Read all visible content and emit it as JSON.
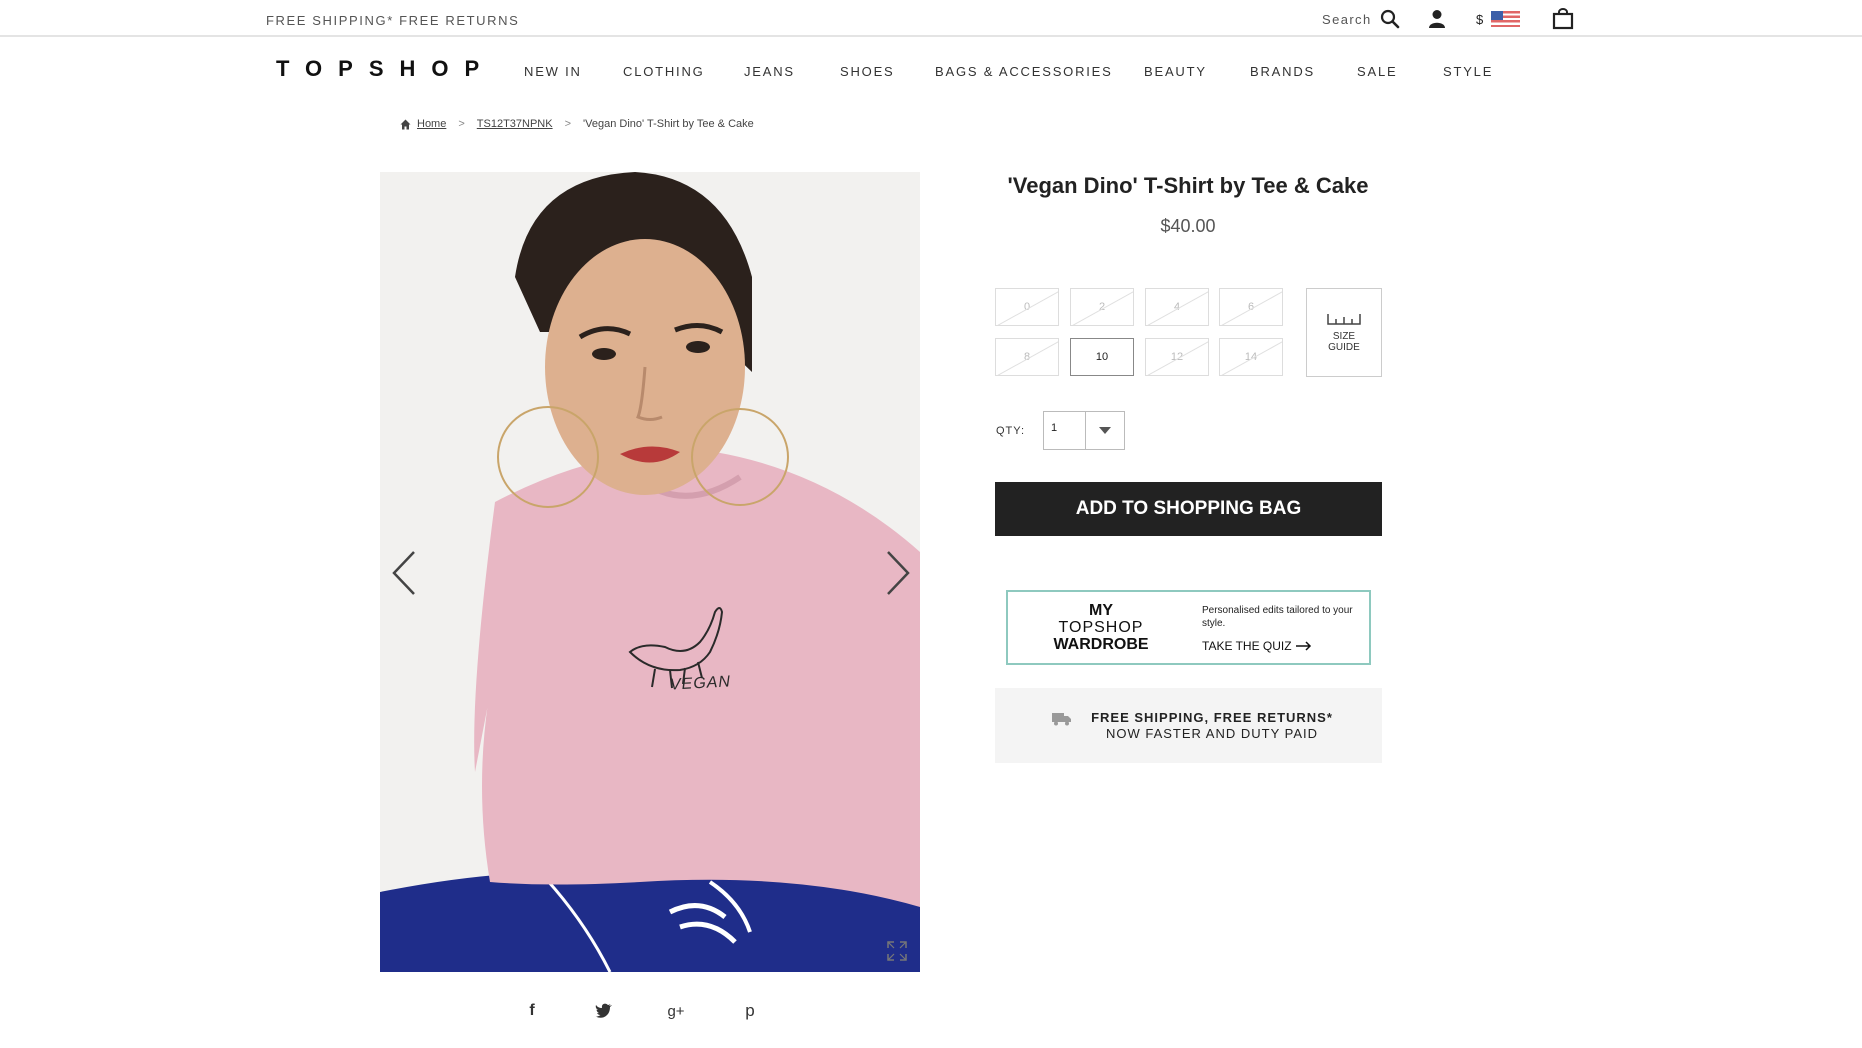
{
  "topbar": {
    "shipping_note": "FREE SHIPPING* FREE RETURNS",
    "search_label": "Search",
    "currency_symbol": "$"
  },
  "brand": {
    "logo_text": "TOPSHOP"
  },
  "nav": {
    "items": [
      "NEW IN",
      "CLOTHING",
      "JEANS",
      "SHOES",
      "BAGS & ACCESSORIES",
      "BEAUTY",
      "BRANDS",
      "SALE",
      "STYLE"
    ]
  },
  "breadcrumb": {
    "home": "Home",
    "code": "TS12T37NPNK",
    "current": "'Vegan Dino' T-Shirt by Tee & Cake"
  },
  "product": {
    "title": "'Vegan Dino' T-Shirt by Tee & Cake",
    "price": "$40.00",
    "image_print_text": "VEGAN",
    "sizes": [
      {
        "label": "0",
        "available": false
      },
      {
        "label": "2",
        "available": false
      },
      {
        "label": "4",
        "available": false
      },
      {
        "label": "6",
        "available": false
      },
      {
        "label": "8",
        "available": false
      },
      {
        "label": "10",
        "available": true
      },
      {
        "label": "12",
        "available": false
      },
      {
        "label": "14",
        "available": false
      }
    ],
    "size_guide_label": "SIZE GUIDE",
    "qty_label": "QTY:",
    "qty_value": "1",
    "add_button": "ADD TO SHOPPING BAG"
  },
  "wardrobe_promo": {
    "logo_line1": "MY",
    "logo_line2": "TOPSHOP",
    "logo_line3": "WARDROBE",
    "text": "Personalised edits tailored to your style.",
    "cta": "TAKE THE QUIZ"
  },
  "shipping_banner": {
    "line1": "FREE SHIPPING, FREE RETURNS*",
    "line2": "NOW FASTER AND DUTY PAID"
  },
  "share": {
    "icons": [
      "facebook-icon",
      "twitter-icon",
      "google-plus-icon",
      "pinterest-icon"
    ],
    "facebook_glyph": "f",
    "google_glyph": "g+",
    "pinterest_glyph": "p"
  },
  "colors": {
    "accent_dark": "#222222",
    "wardrobe_border": "#8ec9bf",
    "banner_bg": "#f4f4f4",
    "shirt_pink": "#e8b7c4",
    "trousers_navy": "#1f2d8a"
  }
}
